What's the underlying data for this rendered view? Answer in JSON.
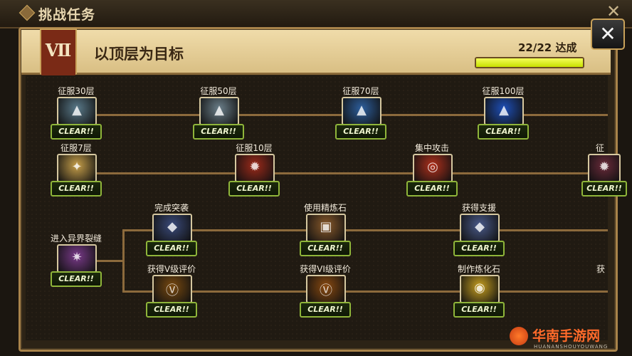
{
  "window": {
    "title": "挑战任务",
    "close_glyph": "✕"
  },
  "quest": {
    "chapter": "Ⅶ",
    "title": "以顶层为目标",
    "progress_text": "22/22 达成",
    "progress_ratio": 1.0
  },
  "clear_label": "CLEAR!!",
  "rows": [
    {
      "nodes": [
        {
          "label": "征服30层",
          "icon": "tower-icon",
          "color": "#5a7a8a"
        },
        {
          "label": "征服50层",
          "icon": "tower-icon",
          "color": "#6b7f8a"
        },
        {
          "label": "征服70层",
          "icon": "tower-icon",
          "color": "#2d5f9e"
        },
        {
          "label": "征服100层",
          "icon": "tower-icon",
          "color": "#1e4fb8"
        }
      ]
    },
    {
      "nodes": [
        {
          "label": "征服7层",
          "icon": "wing-icon",
          "color": "#c8a04a"
        },
        {
          "label": "征服10层",
          "icon": "dragon-icon",
          "color": "#9e2a1a"
        },
        {
          "label": "集中攻击",
          "icon": "target-icon",
          "color": "#b0301c"
        },
        {
          "label": "征",
          "icon": "dragon-icon",
          "color": "#6a2a3a"
        }
      ]
    },
    {
      "nodes": [
        {
          "label": "进入异界裂缝",
          "icon": "rift-icon",
          "color": "#7a3a8a"
        },
        {
          "label": "完成突袭",
          "icon": "beast-icon",
          "color": "#3a4a7a"
        },
        {
          "label": "使用精炼石",
          "icon": "stone-icon",
          "color": "#8a5a2a"
        },
        {
          "label": "获得支援",
          "icon": "beast-icon",
          "color": "#4a5a8a"
        },
        {
          "label": "获得V级评价",
          "icon": "grade-icon",
          "color": "#7a4a10"
        },
        {
          "label": "获得VI级评价",
          "icon": "grade-icon",
          "color": "#8a4a10"
        },
        {
          "label": "制作炼化石",
          "icon": "gem-icon",
          "color": "#c8a020"
        },
        {
          "label": "获",
          "icon": "gem-icon",
          "color": "#6a5a2a"
        }
      ]
    }
  ],
  "watermark": {
    "main": "华南手游网",
    "sub": "HUANANSHOUYOUWANG"
  }
}
